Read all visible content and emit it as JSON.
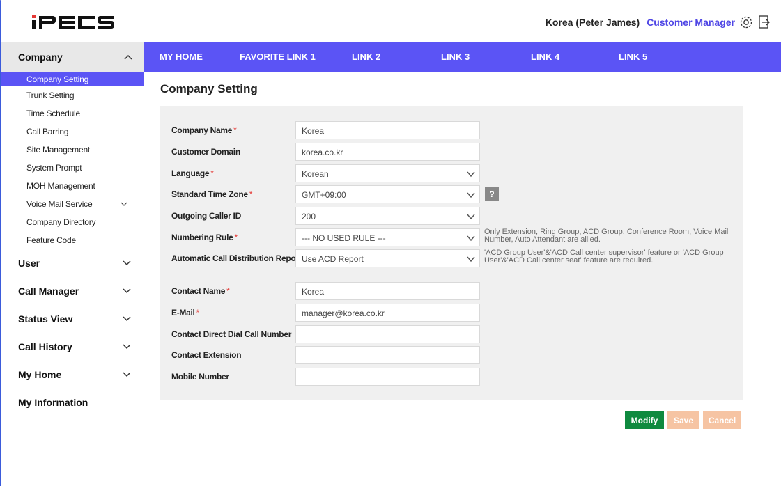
{
  "header": {
    "logo_text": "iPECS",
    "user_name": "Korea (Peter James)",
    "user_role": "Customer Manager"
  },
  "sidebar": {
    "company": {
      "label": "Company",
      "items": [
        {
          "label": "Company Setting",
          "active": true
        },
        {
          "label": "Trunk Setting"
        },
        {
          "label": "Time Schedule"
        },
        {
          "label": "Call Barring"
        },
        {
          "label": "Site Management"
        },
        {
          "label": "System Prompt"
        },
        {
          "label": "MOH Management"
        },
        {
          "label": "Voice Mail Service",
          "expandable": true
        },
        {
          "label": "Company Directory"
        },
        {
          "label": "Feature Code"
        }
      ]
    },
    "groups": [
      {
        "label": "User"
      },
      {
        "label": "Call Manager"
      },
      {
        "label": "Status View"
      },
      {
        "label": "Call History"
      },
      {
        "label": "My Home"
      },
      {
        "label": "My Information"
      }
    ]
  },
  "nav": {
    "links": [
      "MY HOME",
      "FAVORITE LINK 1",
      "LINK 2",
      "LINK 3",
      "LINK 4",
      "LINK 5"
    ]
  },
  "main": {
    "title": "Company Setting",
    "fields": {
      "company_name": {
        "label": "Company Name",
        "value": "Korea"
      },
      "customer_domain": {
        "label": "Customer Domain",
        "value": "korea.co.kr"
      },
      "language": {
        "label": "Language",
        "value": "Korean"
      },
      "time_zone": {
        "label": "Standard Time Zone",
        "value": "GMT+09:00",
        "help": "?"
      },
      "outgoing_caller_id": {
        "label": "Outgoing Caller ID",
        "value": "200"
      },
      "numbering_rule": {
        "label": "Numbering Rule",
        "value": "--- NO USED RULE ---",
        "note": "Only Extension, Ring Group, ACD Group, Conference Room, Voice Mail Number, Auto Attendant are allied."
      },
      "acd_report": {
        "label": "Automatic Call Distribution Report",
        "value": "Use ACD Report",
        "note": "'ACD Group User'&'ACD Call center supervisor' feature or 'ACD Group User'&'ACD Call center seat' feature are required."
      },
      "contact_name": {
        "label": "Contact Name",
        "value": "Korea"
      },
      "email": {
        "label": "E-Mail",
        "value": "manager@korea.co.kr"
      },
      "contact_ddi": {
        "label": "Contact Direct Dial Call Number",
        "value": ""
      },
      "contact_extension": {
        "label": "Contact Extension",
        "value": ""
      },
      "mobile_number": {
        "label": "Mobile Number",
        "value": ""
      }
    },
    "required_mark": "*",
    "buttons": {
      "modify": "Modify",
      "save": "Save",
      "cancel": "Cancel"
    }
  },
  "colors": {
    "accent": "#5b54f5",
    "modify": "#0f8a3f",
    "disabled_button": "#f6c4a3",
    "required": "#e53935"
  }
}
